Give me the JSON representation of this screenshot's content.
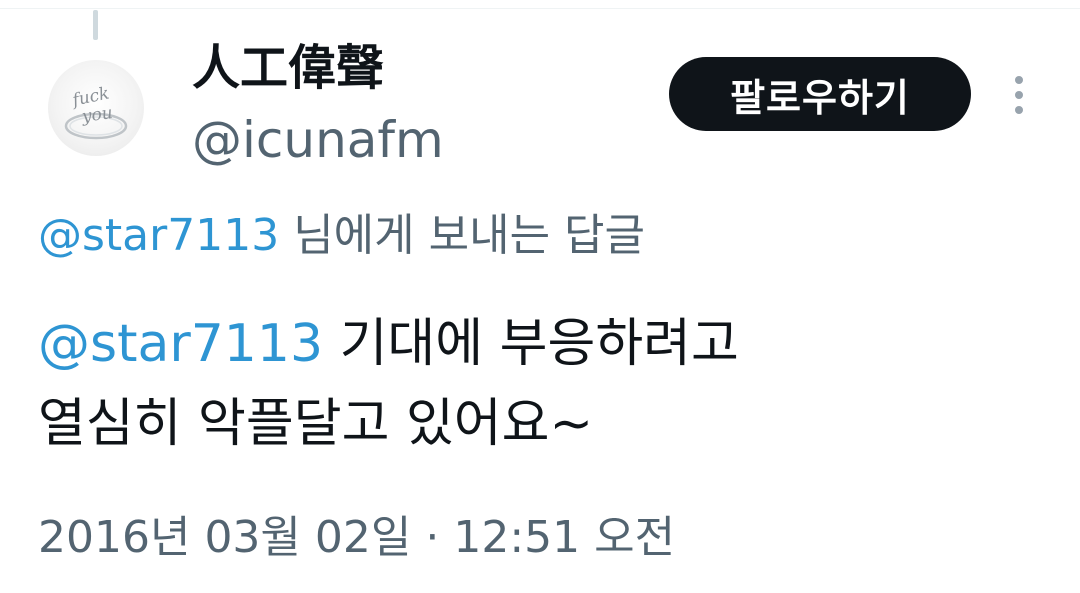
{
  "author": {
    "display_name": "人工偉聲",
    "handle": "@icunafm",
    "avatar_icon": "ring-avatar-icon",
    "avatar_inscription": [
      "fuck",
      "you"
    ]
  },
  "follow_button": {
    "label": "팔로우하기"
  },
  "more_menu": {
    "icon": "more-vertical-icon"
  },
  "reply_context": {
    "mention": "@star7113",
    "suffix": " 님에게 보내는 답글"
  },
  "tweet": {
    "mention": "@star7113",
    "line1_rest": " 기대에 부응하려고",
    "line2": "열심히 악플달고 있어요~"
  },
  "timestamp": {
    "date": "2016년 03월 02일",
    "separator": " · ",
    "time": "12:51 오전"
  },
  "colors": {
    "text": "#0f1419",
    "secondary": "#536471",
    "link": "#2e95d3",
    "button_bg": "#0f1419",
    "button_text": "#ffffff"
  }
}
